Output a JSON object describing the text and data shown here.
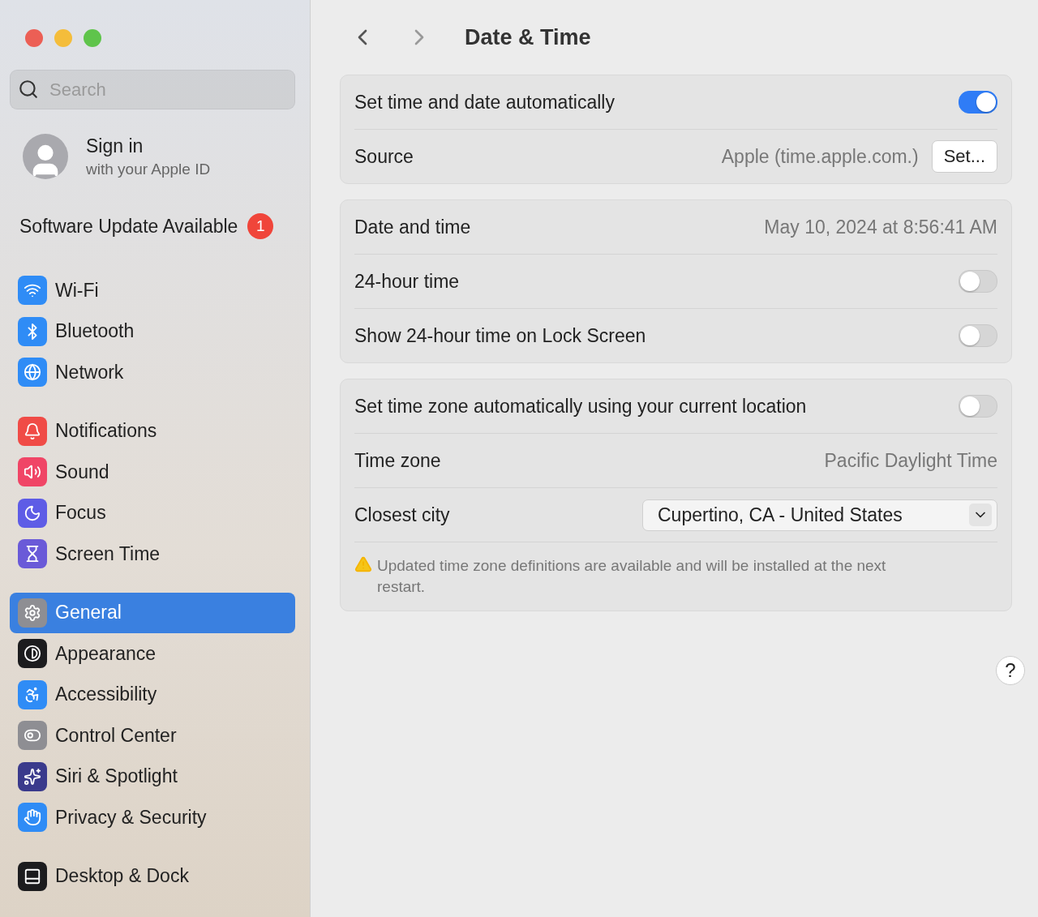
{
  "window": {
    "title": "Date & Time"
  },
  "search": {
    "placeholder": "Search"
  },
  "account": {
    "title": "Sign in",
    "subtitle": "with your Apple ID"
  },
  "update": {
    "label": "Software Update Available",
    "badge": "1"
  },
  "sidebar": {
    "groups": [
      {
        "items": [
          {
            "label": "Wi-Fi",
            "color": "#2f8cf6",
            "selected": false
          },
          {
            "label": "Bluetooth",
            "color": "#2f8cf6",
            "selected": false
          },
          {
            "label": "Network",
            "color": "#2f8cf6",
            "selected": false
          }
        ]
      },
      {
        "items": [
          {
            "label": "Notifications",
            "color": "#f04b46",
            "selected": false
          },
          {
            "label": "Sound",
            "color": "#f04566",
            "selected": false
          },
          {
            "label": "Focus",
            "color": "#5e5ce6",
            "selected": false
          },
          {
            "label": "Screen Time",
            "color": "#6a5ad8",
            "selected": false
          }
        ]
      },
      {
        "items": [
          {
            "label": "General",
            "color": "#8e8e93",
            "selected": true
          },
          {
            "label": "Appearance",
            "color": "#1c1c1e",
            "selected": false
          },
          {
            "label": "Accessibility",
            "color": "#2f8cf6",
            "selected": false
          },
          {
            "label": "Control Center",
            "color": "#8e8e93",
            "selected": false
          },
          {
            "label": "Siri & Spotlight",
            "color": "#3a3a8c",
            "selected": false
          },
          {
            "label": "Privacy & Security",
            "color": "#2f8cf6",
            "selected": false
          }
        ]
      },
      {
        "items": [
          {
            "label": "Desktop & Dock",
            "color": "#1c1c1e",
            "selected": false
          }
        ]
      }
    ]
  },
  "cards": [
    {
      "rows": [
        {
          "kind": "toggle",
          "label": "Set time and date automatically",
          "on": true
        },
        {
          "kind": "value_button",
          "label": "Source",
          "value": "Apple (time.apple.com.)",
          "button": "Set..."
        }
      ]
    },
    {
      "rows": [
        {
          "kind": "value",
          "label": "Date and time",
          "value": "May 10, 2024 at 8:56:41 AM"
        },
        {
          "kind": "toggle",
          "label": "24-hour time",
          "on": false
        },
        {
          "kind": "toggle",
          "label": "Show 24-hour time on Lock Screen",
          "on": false
        }
      ]
    },
    {
      "rows": [
        {
          "kind": "toggle",
          "label": "Set time zone automatically using your current location",
          "on": false
        },
        {
          "kind": "value",
          "label": "Time zone",
          "value": "Pacific Daylight Time"
        },
        {
          "kind": "dropdown",
          "label": "Closest city",
          "value": "Cupertino, CA - United States"
        },
        {
          "kind": "note",
          "text": "Updated time zone definitions are available and will be installed at the next restart."
        }
      ]
    }
  ],
  "help": {
    "label": "?"
  }
}
